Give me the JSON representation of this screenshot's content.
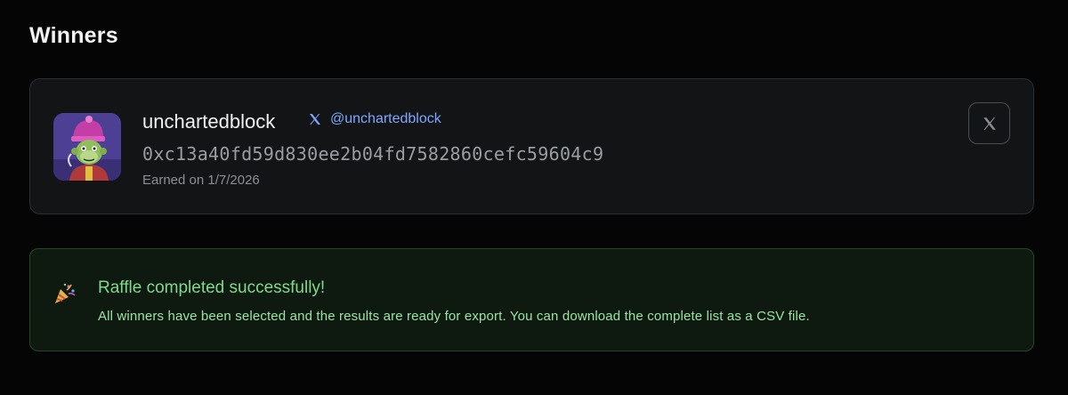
{
  "section": {
    "title": "Winners"
  },
  "winner": {
    "username": "unchartedblock",
    "twitter_handle": "@unchartedblock",
    "wallet": "0xc13a40fd59d830ee2b04fd7582860cefc59604c9",
    "earned": "Earned on 1/7/2026",
    "avatar_icon": "ape-nft-avatar",
    "x_button_icon": "x-logo-icon"
  },
  "banner": {
    "icon": "party-popper-icon",
    "title": "Raffle completed successfully!",
    "text": "All winners have been selected and the results are ready for export. You can download the complete list as a CSV file."
  },
  "colors": {
    "background": "#050505",
    "card": "#121416",
    "accent_link": "#7ea6ff",
    "success_text": "#7fd98a",
    "success_bg": "#0e1a10",
    "success_border": "#1f4a26"
  }
}
